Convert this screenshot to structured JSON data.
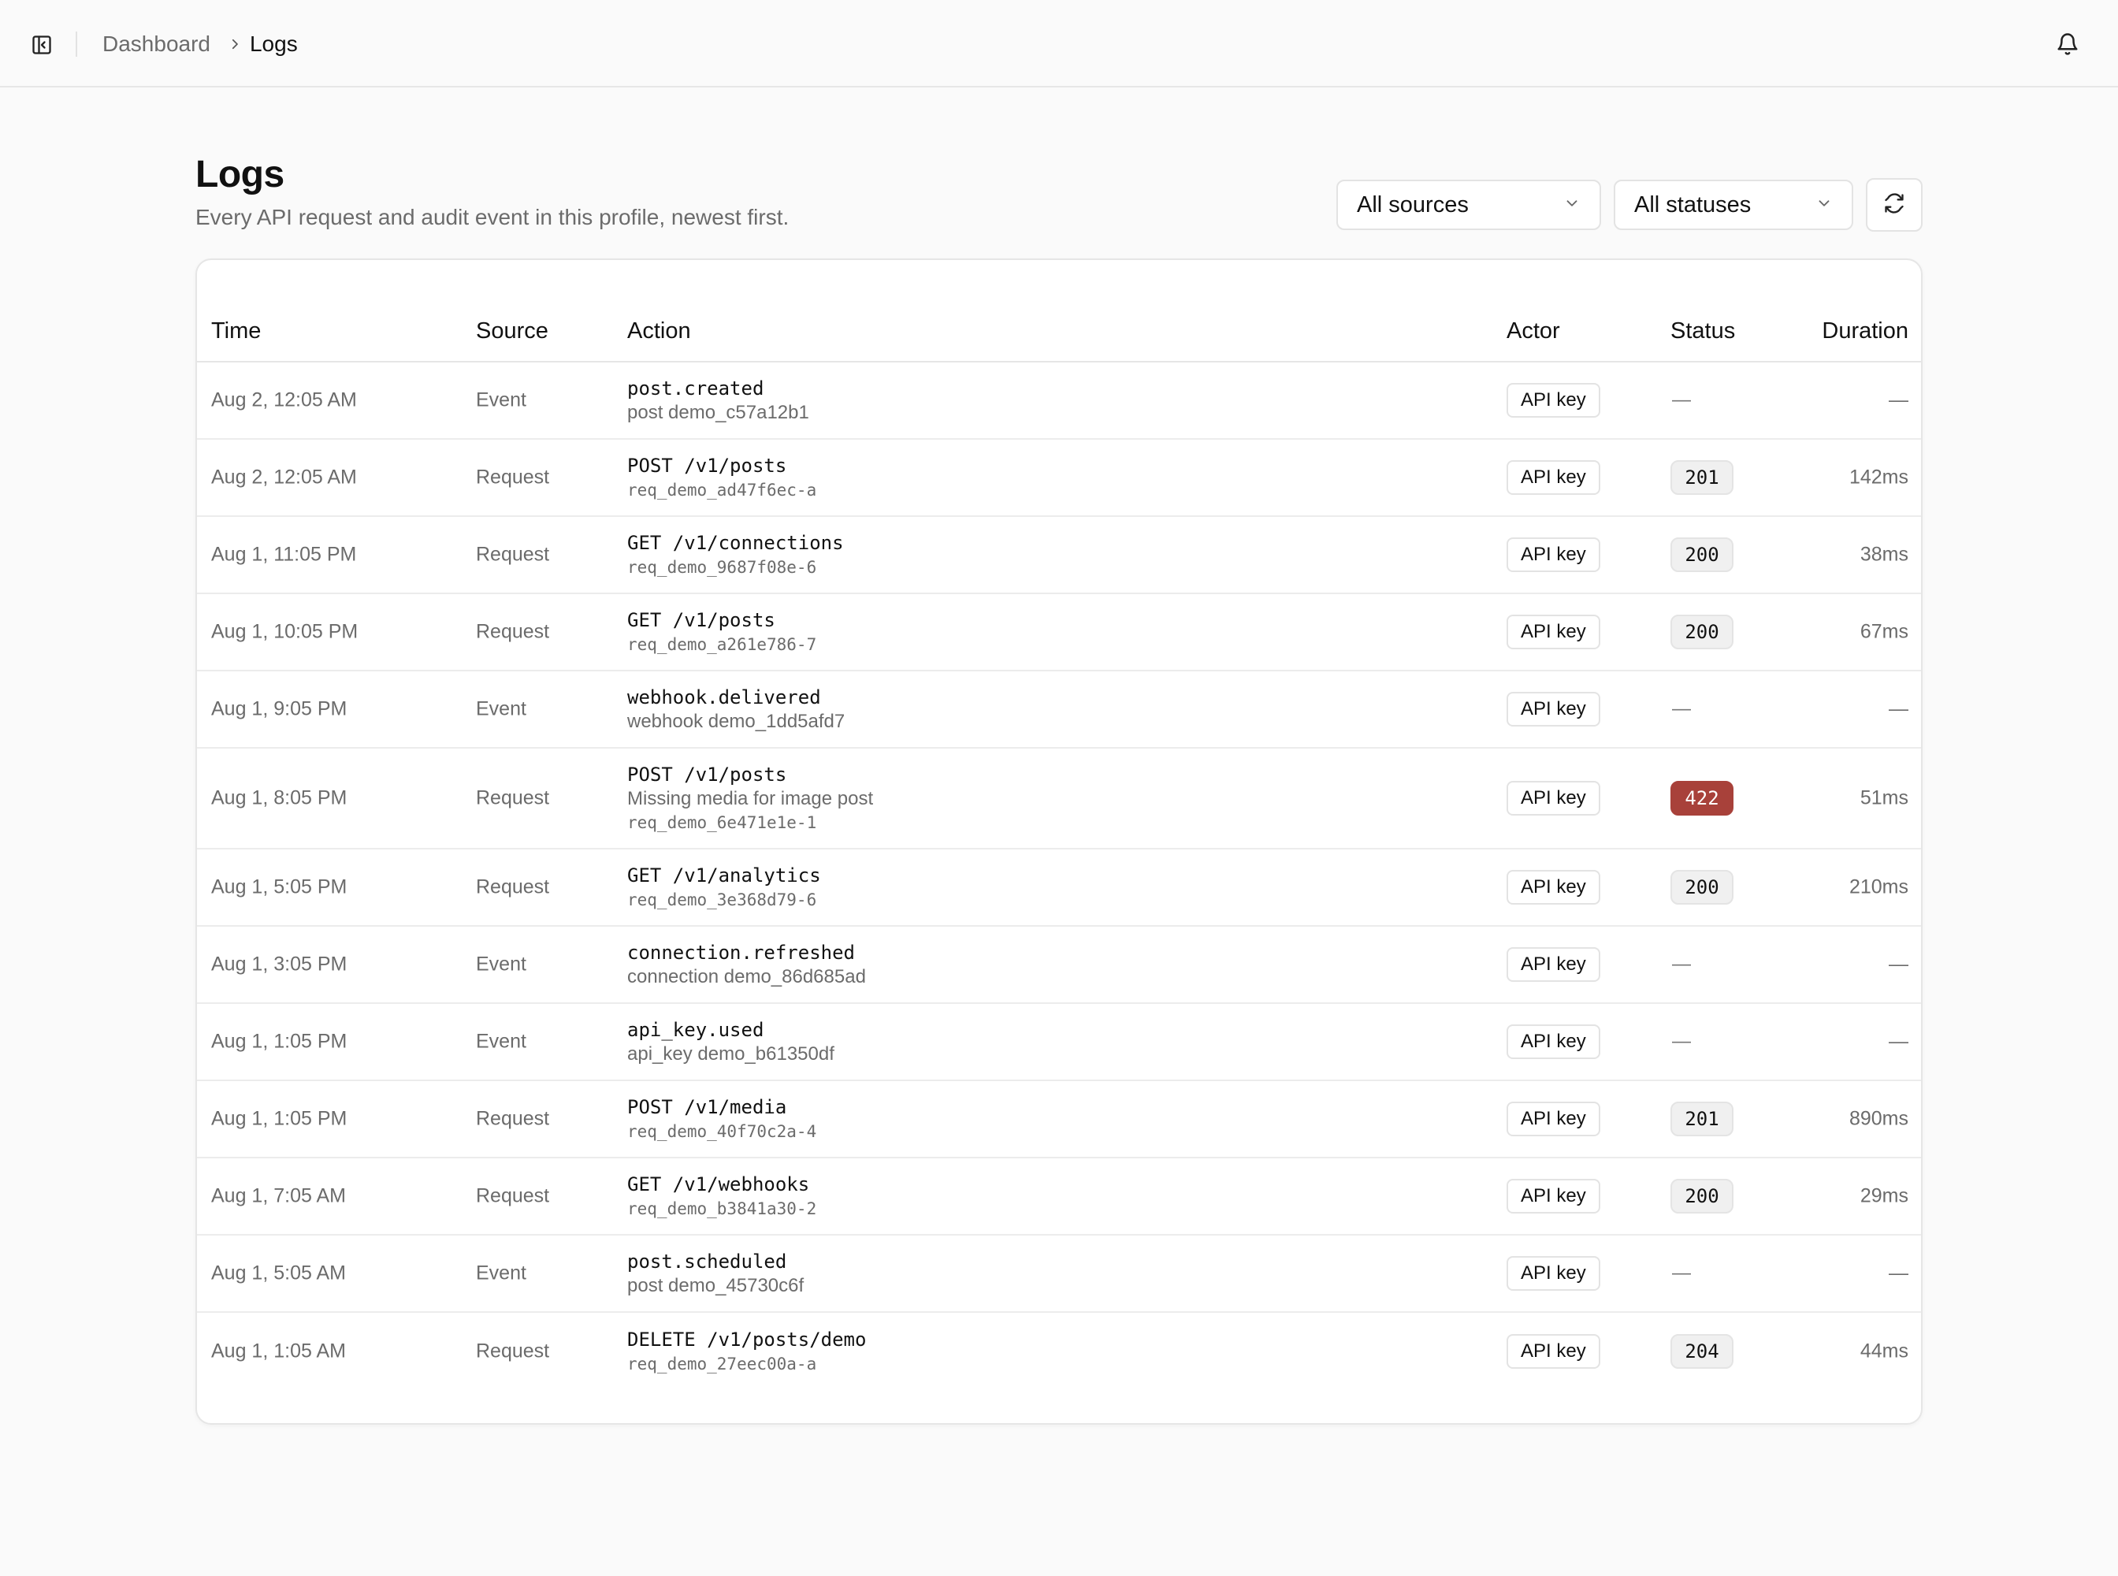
{
  "breadcrumb": {
    "parent": "Dashboard",
    "current": "Logs"
  },
  "page": {
    "title": "Logs",
    "subtitle": "Every API request and audit event in this profile, newest first."
  },
  "filters": {
    "source": "All sources",
    "status": "All statuses"
  },
  "table": {
    "columns": [
      "Time",
      "Source",
      "Action",
      "Actor",
      "Status",
      "Duration"
    ],
    "rows": [
      {
        "time": "Aug 2, 12:05 AM",
        "source": "Event",
        "action": "post.created",
        "sub": "post demo_c57a12b1",
        "sub_mono": false,
        "actor": "API key",
        "status": "—",
        "duration": "—"
      },
      {
        "time": "Aug 2, 12:05 AM",
        "source": "Request",
        "action": "POST /v1/posts",
        "sub": "req_demo_ad47f6ec-a",
        "sub_mono": true,
        "actor": "API key",
        "status": "201",
        "duration": "142ms"
      },
      {
        "time": "Aug 1, 11:05 PM",
        "source": "Request",
        "action": "GET /v1/connections",
        "sub": "req_demo_9687f08e-6",
        "sub_mono": true,
        "actor": "API key",
        "status": "200",
        "duration": "38ms"
      },
      {
        "time": "Aug 1, 10:05 PM",
        "source": "Request",
        "action": "GET /v1/posts",
        "sub": "req_demo_a261e786-7",
        "sub_mono": true,
        "actor": "API key",
        "status": "200",
        "duration": "67ms"
      },
      {
        "time": "Aug 1, 9:05 PM",
        "source": "Event",
        "action": "webhook.delivered",
        "sub": "webhook demo_1dd5afd7",
        "sub_mono": false,
        "actor": "API key",
        "status": "—",
        "duration": "—"
      },
      {
        "time": "Aug 1, 8:05 PM",
        "source": "Request",
        "action": "POST /v1/posts",
        "error": "Missing media for image post",
        "sub": "req_demo_6e471e1e-1",
        "sub_mono": true,
        "actor": "API key",
        "status": "422",
        "status_error": true,
        "duration": "51ms"
      },
      {
        "time": "Aug 1, 5:05 PM",
        "source": "Request",
        "action": "GET /v1/analytics",
        "sub": "req_demo_3e368d79-6",
        "sub_mono": true,
        "actor": "API key",
        "status": "200",
        "duration": "210ms"
      },
      {
        "time": "Aug 1, 3:05 PM",
        "source": "Event",
        "action": "connection.refreshed",
        "sub": "connection demo_86d685ad",
        "sub_mono": false,
        "actor": "API key",
        "status": "—",
        "duration": "—"
      },
      {
        "time": "Aug 1, 1:05 PM",
        "source": "Event",
        "action": "api_key.used",
        "sub": "api_key demo_b61350df",
        "sub_mono": false,
        "actor": "API key",
        "status": "—",
        "duration": "—"
      },
      {
        "time": "Aug 1, 1:05 PM",
        "source": "Request",
        "action": "POST /v1/media",
        "sub": "req_demo_40f70c2a-4",
        "sub_mono": true,
        "actor": "API key",
        "status": "201",
        "duration": "890ms"
      },
      {
        "time": "Aug 1, 7:05 AM",
        "source": "Request",
        "action": "GET /v1/webhooks",
        "sub": "req_demo_b3841a30-2",
        "sub_mono": true,
        "actor": "API key",
        "status": "200",
        "duration": "29ms"
      },
      {
        "time": "Aug 1, 5:05 AM",
        "source": "Event",
        "action": "post.scheduled",
        "sub": "post demo_45730c6f",
        "sub_mono": false,
        "actor": "API key",
        "status": "—",
        "duration": "—"
      },
      {
        "time": "Aug 1, 1:05 AM",
        "source": "Request",
        "action": "DELETE /v1/posts/demo",
        "sub": "req_demo_27eec00a-a",
        "sub_mono": true,
        "actor": "API key",
        "status": "204",
        "duration": "44ms"
      }
    ]
  },
  "icons": {
    "sidebar_toggle": "sidebar-toggle-icon",
    "breadcrumb_separator": "chevron-right-icon",
    "notifications": "bell-icon",
    "select_caret": "chevron-down-icon",
    "refresh": "refresh-icon"
  },
  "colors": {
    "error_status": "#a8413a",
    "muted_text": "#6b6b6b",
    "border": "#e6e6e6",
    "background": "#fafafa"
  }
}
